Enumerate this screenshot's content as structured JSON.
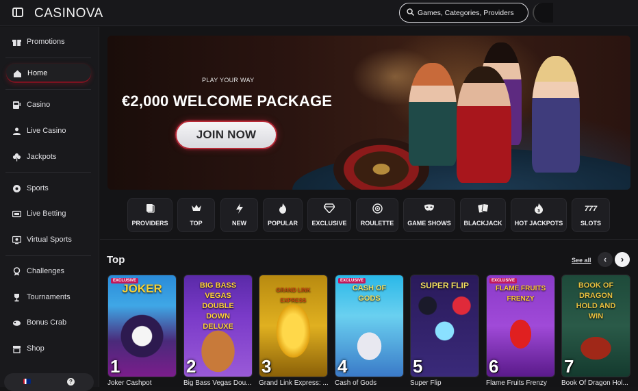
{
  "topbar": {
    "logo": "CASINOVA",
    "search_placeholder": "Games, Categories, Providers"
  },
  "sidebar": {
    "items": [
      {
        "label": "Promotions",
        "icon": "gift-icon"
      },
      {
        "label": "Home",
        "icon": "home-icon",
        "active": true
      },
      {
        "label": "Casino",
        "icon": "slot-machine-icon"
      },
      {
        "label": "Live Casino",
        "icon": "live-dealer-icon"
      },
      {
        "label": "Jackpots",
        "icon": "clover-icon"
      },
      {
        "label": "Sports",
        "icon": "soccer-ball-icon"
      },
      {
        "label": "Live Betting",
        "icon": "live-tv-icon"
      },
      {
        "label": "Virtual Sports",
        "icon": "virtual-sports-icon"
      },
      {
        "label": "Challenges",
        "icon": "medal-icon"
      },
      {
        "label": "Tournaments",
        "icon": "trophy-icon"
      },
      {
        "label": "Bonus Crab",
        "icon": "crab-icon"
      },
      {
        "label": "Shop",
        "icon": "shop-icon"
      }
    ]
  },
  "hero": {
    "subtitle": "PLAY YOUR WAY",
    "title": "€2,000 WELCOME PACKAGE",
    "cta": "JOIN NOW"
  },
  "categories": [
    {
      "label": "PROVIDERS",
      "icon": "providers-icon"
    },
    {
      "label": "TOP",
      "icon": "crown-icon"
    },
    {
      "label": "NEW",
      "icon": "lightning-icon"
    },
    {
      "label": "POPULAR",
      "icon": "flame-icon"
    },
    {
      "label": "EXCLUSIVE",
      "icon": "diamond-icon"
    },
    {
      "label": "ROULETTE",
      "icon": "roulette-icon"
    },
    {
      "label": "GAME SHOWS",
      "icon": "mask-icon"
    },
    {
      "label": "BLACKJACK",
      "icon": "cards-icon"
    },
    {
      "label": "HOT JACKPOTS",
      "icon": "hot-jackpot-icon"
    },
    {
      "label": "SLOTS",
      "icon": "777-icon"
    }
  ],
  "section": {
    "title": "Top",
    "see_all": "See all"
  },
  "games": [
    {
      "rank": "1",
      "name": "Joker Cashpot",
      "art_title": "JOKER",
      "badge": "EXCLUSIVE"
    },
    {
      "rank": "2",
      "name": "Big Bass Vegas Dou...",
      "art_title": "BIG BASS VEGAS DOUBLE DOWN DELUXE"
    },
    {
      "rank": "3",
      "name": "Grand Link Express: ...",
      "art_title": "GRAND LINK EXPRESS"
    },
    {
      "rank": "4",
      "name": "Cash of Gods",
      "art_title": "CASH OF GODS",
      "badge": "EXCLUSIVE"
    },
    {
      "rank": "5",
      "name": "Super Flip",
      "art_title": "SUPER FLIP"
    },
    {
      "rank": "6",
      "name": "Flame Fruits Frenzy",
      "art_title": "FLAME FRUITS FRENZY",
      "badge": "EXCLUSIVE"
    },
    {
      "rank": "7",
      "name": "Book Of Dragon Hol...",
      "art_title": "BOOK OF DRAGON HOLD AND WIN"
    }
  ],
  "colors": {
    "accent": "#b72a37",
    "background": "#141416",
    "sidebar": "#19191c"
  }
}
